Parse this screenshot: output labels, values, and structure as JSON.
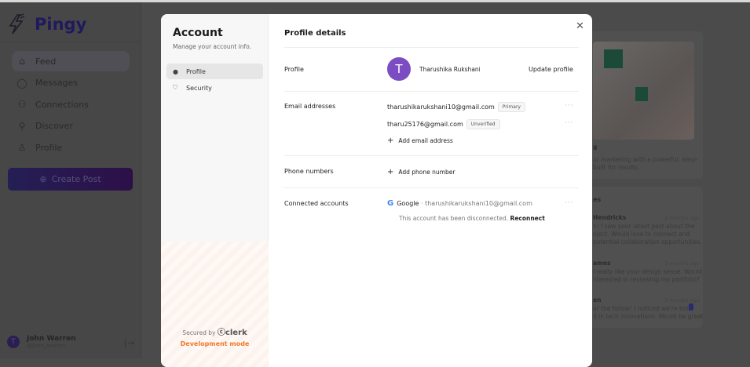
{
  "app": {
    "name": "Pingy"
  },
  "sidebar": {
    "items": [
      {
        "label": "Feed",
        "icon": "home-icon",
        "active": true
      },
      {
        "label": "Messages",
        "icon": "message-icon"
      },
      {
        "label": "Connections",
        "icon": "users-icon"
      },
      {
        "label": "Discover",
        "icon": "search-icon"
      },
      {
        "label": "Profile",
        "icon": "user-icon"
      }
    ],
    "create_post": "Create Post",
    "user": {
      "initial": "T",
      "name": "John Warren",
      "handle": "@john_warren"
    }
  },
  "background": {
    "ad_title": "g",
    "ad_text": [
      "ur marketing with a powerful, easy-",
      "built for results."
    ],
    "messages_title": "es",
    "messages": [
      {
        "name": "Hendricks",
        "time": "2 months ago",
        "lines": [
          "n! I saw your latest post about the",
          "oject. Would love to connect and",
          "potential collaboration opportunities."
        ]
      },
      {
        "name": "ames",
        "time": "3 months ago",
        "lines": [
          "I really like your design sense. Would",
          "nterested in reviewing my portfolio?"
        ]
      },
      {
        "name": "en",
        "time": "3 months ago",
        "lines": [
          "or the follow! I noticed we're both",
          "d in tech innovations. Would be great"
        ],
        "badge": "1"
      }
    ]
  },
  "modal": {
    "title": "Account",
    "subtitle": "Manage your account info.",
    "nav": [
      {
        "label": "Profile",
        "active": true
      },
      {
        "label": "Security"
      }
    ],
    "secured_by": "Secured by",
    "clerk": "clerk",
    "dev_mode": "Development mode",
    "heading": "Profile details",
    "profile": {
      "label": "Profile",
      "initial": "T",
      "name": "Tharushika Rukshani",
      "update": "Update profile",
      "avatar_color": "#7b4cc2"
    },
    "emails": {
      "label": "Email addresses",
      "items": [
        {
          "email": "tharushikarukshani10@gmail.com",
          "badge": "Primary"
        },
        {
          "email": "tharu25176@gmail.com",
          "badge": "Unverified"
        }
      ],
      "add": "Add email address"
    },
    "phones": {
      "label": "Phone numbers",
      "add": "Add phone number"
    },
    "connected": {
      "label": "Connected accounts",
      "provider": "Google",
      "email": "tharushikarukshani10@gmail.com",
      "status": "This account has been disconnected.",
      "reconnect": "Reconnect"
    }
  }
}
